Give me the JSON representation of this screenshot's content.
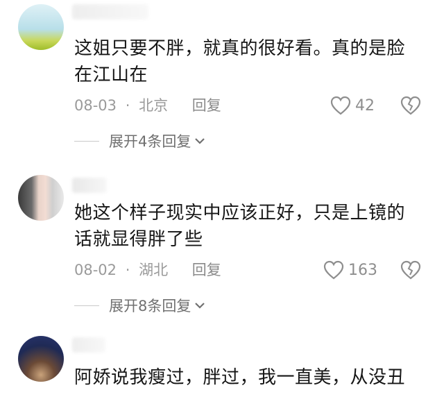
{
  "comments": [
    {
      "text": "这姐只要不胖，就真的很好看。真的是脸在江山在",
      "date": "08-03",
      "location": "北京",
      "reply_label": "回复",
      "likes": "42",
      "expand_label": "展开4条回复"
    },
    {
      "text": "她这个样子现实中应该正好，只是上镜的话就显得胖了些",
      "date": "08-02",
      "location": "湖北",
      "reply_label": "回复",
      "likes": "163",
      "expand_label": "展开8条回复"
    },
    {
      "text": "阿娇说我瘦过，胖过，我一直美，从没丑"
    }
  ],
  "separator": "·",
  "icons": {
    "like": "heart-outline-icon",
    "dislike": "broken-heart-icon",
    "expand": "chevron-down-icon"
  }
}
